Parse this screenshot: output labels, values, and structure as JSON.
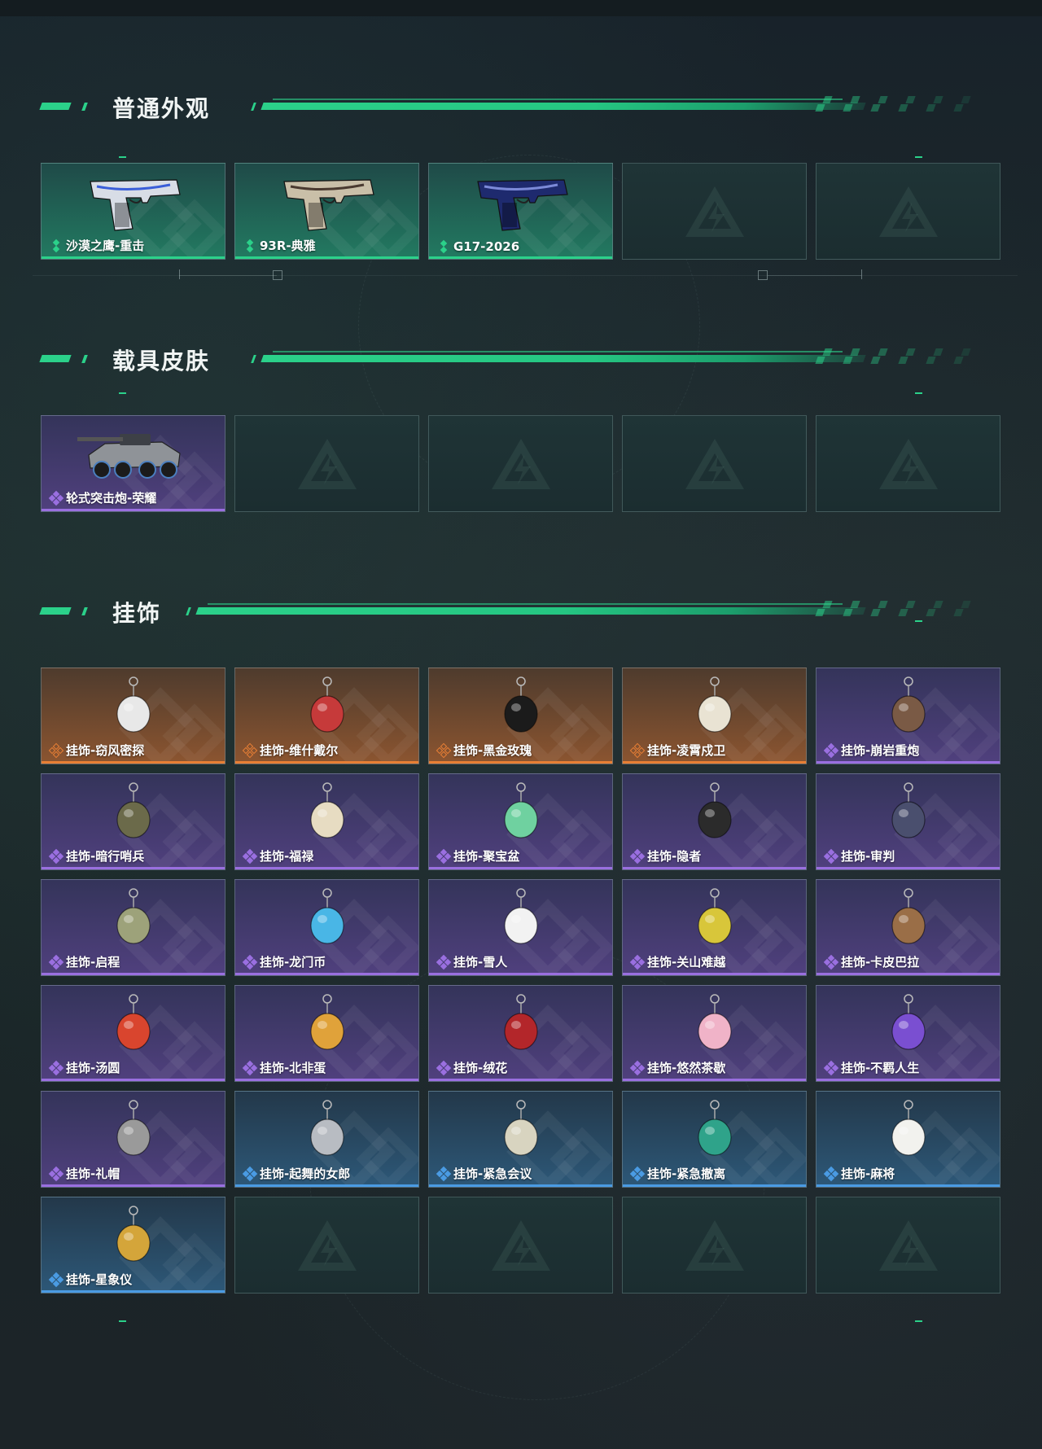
{
  "sections": [
    {
      "title": "普通外观",
      "items": [
        {
          "label": "沙漠之鹰-重击",
          "rarity": "green",
          "art": "pistol-icon",
          "art_color": "#d8dde6",
          "accent": "#3a5ed8"
        },
        {
          "label": "93R-典雅",
          "rarity": "green",
          "art": "pistol-icon",
          "art_color": "#c9bfa8",
          "accent": "#4a3a30"
        },
        {
          "label": "G17-2026",
          "rarity": "green",
          "art": "pistol-icon",
          "art_color": "#1e2a6e",
          "accent": "#7c8ad8"
        },
        {
          "empty": true
        },
        {
          "empty": true
        }
      ]
    },
    {
      "title": "载具皮肤",
      "items": [
        {
          "label": "轮式突击炮-荣耀",
          "rarity": "purple",
          "art": "vehicle-icon",
          "art_color": "#8f9398",
          "accent": "#3d4046"
        },
        {
          "empty": true
        },
        {
          "empty": true
        },
        {
          "empty": true
        },
        {
          "empty": true
        }
      ]
    },
    {
      "title": "挂饰",
      "items": [
        {
          "label": "挂饰-窃风密探",
          "rarity": "orange",
          "art": "charm-icon",
          "art_color": "#e8e8e8"
        },
        {
          "label": "挂饰-维什戴尔",
          "rarity": "orange",
          "art": "charm-icon",
          "art_color": "#c63a3a"
        },
        {
          "label": "挂饰-黑金玫瑰",
          "rarity": "orange",
          "art": "charm-icon",
          "art_color": "#1b1b1b"
        },
        {
          "label": "挂饰-凌霄戍卫",
          "rarity": "orange",
          "art": "charm-icon",
          "art_color": "#e9e3d3"
        },
        {
          "label": "挂饰-崩岩重炮",
          "rarity": "purple",
          "art": "charm-icon",
          "art_color": "#7a5a45"
        },
        {
          "label": "挂饰-暗行哨兵",
          "rarity": "purple",
          "art": "charm-icon",
          "art_color": "#6b6a4a"
        },
        {
          "label": "挂饰-福禄",
          "rarity": "purple",
          "art": "charm-icon",
          "art_color": "#e7dcc2"
        },
        {
          "label": "挂饰-聚宝盆",
          "rarity": "purple",
          "art": "charm-icon",
          "art_color": "#6fd1a0"
        },
        {
          "label": "挂饰-隐者",
          "rarity": "purple",
          "art": "charm-icon",
          "art_color": "#2b2b2b"
        },
        {
          "label": "挂饰-审判",
          "rarity": "purple",
          "art": "charm-icon",
          "art_color": "#4a4f6e"
        },
        {
          "label": "挂饰-启程",
          "rarity": "purple",
          "art": "charm-icon",
          "art_color": "#9da27a"
        },
        {
          "label": "挂饰-龙门币",
          "rarity": "purple",
          "art": "charm-icon",
          "art_color": "#49b6e6"
        },
        {
          "label": "挂饰-雪人",
          "rarity": "purple",
          "art": "charm-icon",
          "art_color": "#f2f2f2"
        },
        {
          "label": "挂饰-关山难越",
          "rarity": "purple",
          "art": "charm-icon",
          "art_color": "#d8c63a"
        },
        {
          "label": "挂饰-卡皮巴拉",
          "rarity": "purple",
          "art": "charm-icon",
          "art_color": "#9a6e47"
        },
        {
          "label": "挂饰-汤圆",
          "rarity": "purple",
          "art": "charm-icon",
          "art_color": "#d9452e"
        },
        {
          "label": "挂饰-北非蛋",
          "rarity": "purple",
          "art": "charm-icon",
          "art_color": "#e0a23a"
        },
        {
          "label": "挂饰-绒花",
          "rarity": "purple",
          "art": "charm-icon",
          "art_color": "#b3262a"
        },
        {
          "label": "挂饰-悠然茶歇",
          "rarity": "purple",
          "art": "charm-icon",
          "art_color": "#f0b3c8"
        },
        {
          "label": "挂饰-不羁人生",
          "rarity": "purple",
          "art": "charm-icon",
          "art_color": "#7a4fd1"
        },
        {
          "label": "挂饰-礼帽",
          "rarity": "purple",
          "art": "charm-icon",
          "art_color": "#9a9a9a"
        },
        {
          "label": "挂饰-起舞的女郎",
          "rarity": "blue",
          "art": "charm-icon",
          "art_color": "#b8bcc2"
        },
        {
          "label": "挂饰-紧急会议",
          "rarity": "blue",
          "art": "charm-icon",
          "art_color": "#d8d4c0"
        },
        {
          "label": "挂饰-紧急撤离",
          "rarity": "blue",
          "art": "charm-icon",
          "art_color": "#2fa38a"
        },
        {
          "label": "挂饰-麻将",
          "rarity": "blue",
          "art": "charm-icon",
          "art_color": "#f2f2ee"
        },
        {
          "label": "挂饰-星象仪",
          "rarity": "blue",
          "art": "charm-icon",
          "art_color": "#d4a53a"
        },
        {
          "empty": true
        },
        {
          "empty": true
        },
        {
          "empty": true
        },
        {
          "empty": true
        }
      ]
    }
  ],
  "empty_icon": "brand-logo-icon",
  "colors": {
    "accent": "#2bd18a",
    "green": "#2bd18a",
    "purple": "#9a6fe0",
    "orange": "#e87f35",
    "blue": "#4a9be3"
  }
}
